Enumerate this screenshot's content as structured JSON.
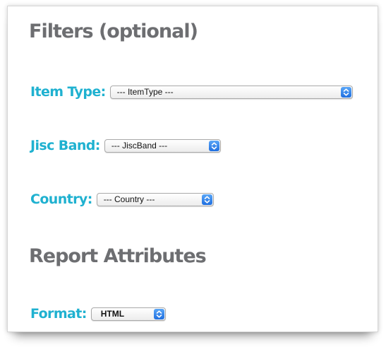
{
  "filters": {
    "heading": "Filters (optional)",
    "item_type": {
      "label": "Item Type:",
      "value": "--- ItemType ---"
    },
    "jisc_band": {
      "label": "Jisc Band:",
      "value": "--- JiscBand ---"
    },
    "country": {
      "label": "Country:",
      "value": "--- Country ---"
    }
  },
  "report": {
    "heading": "Report Attributes",
    "format": {
      "label": "Format:",
      "value": "HTML"
    }
  },
  "icons": {
    "select_arrow": "chevron-up-down-icon"
  },
  "colors": {
    "label": "#1fb1d0",
    "heading": "#6d6e71",
    "select_button": "#2f80ed"
  }
}
